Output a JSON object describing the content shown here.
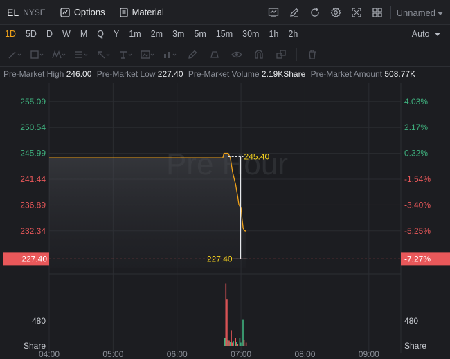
{
  "header": {
    "symbol": "EL",
    "exchange": "NYSE",
    "options_label": "Options",
    "material_label": "Material",
    "layout_name": "Unnamed"
  },
  "timeframes": [
    {
      "label": "1D",
      "active": true
    },
    {
      "label": "5D",
      "active": false
    },
    {
      "label": "D",
      "active": false
    },
    {
      "label": "W",
      "active": false
    },
    {
      "label": "M",
      "active": false
    },
    {
      "label": "Q",
      "active": false
    },
    {
      "label": "Y",
      "active": false
    },
    {
      "label": "1m",
      "active": false
    },
    {
      "label": "2m",
      "active": false
    },
    {
      "label": "3m",
      "active": false
    },
    {
      "label": "5m",
      "active": false
    },
    {
      "label": "15m",
      "active": false
    },
    {
      "label": "30m",
      "active": false
    },
    {
      "label": "1h",
      "active": false
    },
    {
      "label": "2h",
      "active": false
    }
  ],
  "scale_mode": "Auto",
  "premarket": {
    "high_label": "Pre-Market High",
    "high": "246.00",
    "low_label": "Pre-Market Low",
    "low": "227.40",
    "volume_label": "Pre-Market Volume",
    "volume": "2.19KShare",
    "amount_label": "Pre-Market Amount",
    "amount": "508.77K"
  },
  "colors": {
    "background": "#1c1d21",
    "up": "#3fb27f",
    "down": "#e9585a",
    "line": "#f0a21a",
    "label_yellow": "#f5d21e"
  },
  "chart_data": {
    "type": "line",
    "watermark": "Pre Hour",
    "x_ticks": [
      "04:00",
      "05:00",
      "06:00",
      "07:00",
      "08:00",
      "09:00"
    ],
    "x_range": [
      "04:00",
      "09:30"
    ],
    "y_ticks_price": [
      "255.09",
      "250.54",
      "245.99",
      "241.44",
      "236.89",
      "232.34"
    ],
    "y_ticks_price_colors": [
      "up",
      "up",
      "up",
      "down",
      "down",
      "down"
    ],
    "y_ticks_pct": [
      "4.03%",
      "2.17%",
      "0.32%",
      "-1.54%",
      "-3.40%",
      "-5.25%"
    ],
    "y_ticks_pct_colors": [
      "up",
      "up",
      "up",
      "down",
      "down",
      "down"
    ],
    "y_range": [
      225.5,
      257.5
    ],
    "prev_close": 245.2,
    "current_price_label": "227.40",
    "current_pct_label": "-7.27%",
    "current_price": 227.4,
    "high_marker": {
      "label": "245.40",
      "value": 245.4
    },
    "low_marker": {
      "label": "227.40",
      "value": 227.4
    },
    "price_series": {
      "x": [
        "04:00",
        "06:40",
        "06:43",
        "06:44",
        "06:48",
        "06:50",
        "06:52",
        "06:53",
        "06:55",
        "06:56",
        "06:57",
        "06:58",
        "06:59",
        "07:00",
        "07:01",
        "07:02",
        "07:03",
        "07:04",
        "07:05"
      ],
      "y": [
        245.2,
        245.2,
        245.2,
        246.0,
        246.0,
        245.2,
        242.8,
        242.0,
        240.5,
        239.4,
        238.3,
        237.0,
        236.6,
        236.5,
        234.5,
        232.8,
        232.5,
        232.3,
        232.4
      ]
    },
    "volume_axis_label": "Share",
    "volume_tick": "480",
    "volume_tick_value": 480,
    "volume_series": {
      "x": [
        "06:45",
        "06:46",
        "06:47",
        "06:48",
        "06:49",
        "06:50",
        "06:51",
        "06:52",
        "06:53",
        "06:55",
        "06:56",
        "06:57",
        "06:59",
        "07:00",
        "07:02",
        "07:03",
        "07:05"
      ],
      "y": [
        150,
        1200,
        900,
        120,
        100,
        80,
        300,
        60,
        90,
        150,
        80,
        40,
        150,
        60,
        510,
        120,
        60
      ],
      "dir": [
        "up",
        "down",
        "down",
        "up",
        "down",
        "up",
        "down",
        "down",
        "up",
        "down",
        "up",
        "down",
        "up",
        "up",
        "up",
        "down",
        "down"
      ]
    }
  }
}
